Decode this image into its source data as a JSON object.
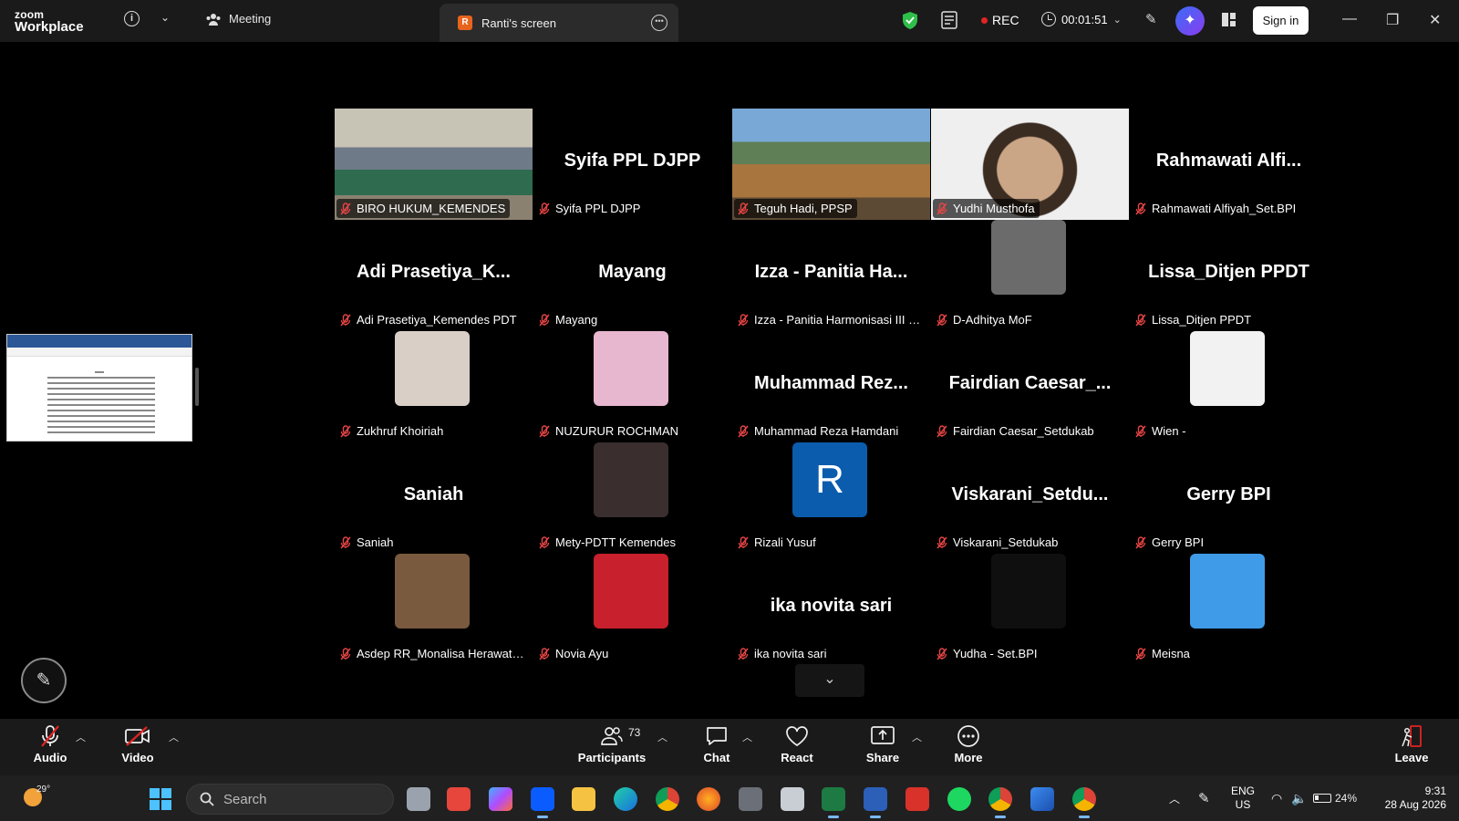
{
  "app": {
    "logo_line1": "zoom",
    "logo_line2": "Workplace"
  },
  "titlebar": {
    "meeting_label": "Meeting",
    "tab_badge": "R",
    "tab_label": "Ranti's screen",
    "rec_label": "REC",
    "timer": "00:01:51",
    "signin_label": "Sign in",
    "colors": {
      "rec": "#e02424",
      "shield": "#2fbf4a",
      "active_speaker": "#2fdc5a"
    }
  },
  "participants": [
    {
      "name": "BIRO HUKUM_KEMENDES",
      "display": "",
      "kind": "video",
      "fill": "img-room",
      "active": true
    },
    {
      "name": "Syifa PPL DJPP",
      "display": "Syifa PPL DJPP",
      "kind": "name"
    },
    {
      "name": "Teguh Hadi, PPSP",
      "display": "",
      "kind": "video",
      "fill": "img-houses"
    },
    {
      "name": "Yudhi Musthofa",
      "display": "",
      "kind": "video",
      "fill": "img-face"
    },
    {
      "name": "Rahmawati Alfiyah_Set.BPI",
      "display": "Rahmawati  Alfi...",
      "kind": "name"
    },
    {
      "name": "Adi Prasetiya_Kemendes PDT",
      "display": "Adi  Prasetiya_K...",
      "kind": "name"
    },
    {
      "name": "Mayang",
      "display": "Mayang",
      "kind": "name"
    },
    {
      "name": "Izza - Panitia Harmonisasi III RP...",
      "display": "Izza  -  Panitia  Ha...",
      "kind": "name"
    },
    {
      "name": "D-Adhitya MoF",
      "display": "",
      "kind": "avatar",
      "color": "#6b6b6b"
    },
    {
      "name": "Lissa_Ditjen PPDT",
      "display": "Lissa_Ditjen PPDT",
      "kind": "name"
    },
    {
      "name": "Zukhruf Khoiriah",
      "display": "",
      "kind": "avatar",
      "color": "#d9cfc7"
    },
    {
      "name": "NUZURUR ROCHMAN",
      "display": "",
      "kind": "avatar",
      "color": "#e7b6cf"
    },
    {
      "name": "Muhammad Reza Hamdani",
      "display": "Muhammad  Rez...",
      "kind": "name"
    },
    {
      "name": "Fairdian Caesar_Setdukab",
      "display": "Fairdian  Caesar_...",
      "kind": "name"
    },
    {
      "name": "Wien -",
      "display": "",
      "kind": "avatar",
      "color": "#f2f2f2"
    },
    {
      "name": "Saniah",
      "display": "Saniah",
      "kind": "name"
    },
    {
      "name": "Mety-PDTT Kemendes",
      "display": "",
      "kind": "avatar",
      "color": "#3a2e2e"
    },
    {
      "name": "Rizali Yusuf",
      "display": "R",
      "kind": "letter",
      "color": "#0b5cad"
    },
    {
      "name": "Viskarani_Setdukab",
      "display": "Viskarani_Setdu...",
      "kind": "name"
    },
    {
      "name": "Gerry BPI",
      "display": "Gerry BPI",
      "kind": "name"
    },
    {
      "name": "Asdep RR_Monalisa Herawati R...",
      "display": "",
      "kind": "avatar",
      "color": "#7a5a3e"
    },
    {
      "name": "Novia Ayu",
      "display": "",
      "kind": "avatar",
      "color": "#c8202c"
    },
    {
      "name": "ika novita sari",
      "display": "ika novita sari",
      "kind": "name"
    },
    {
      "name": "Yudha - Set.BPI",
      "display": "",
      "kind": "avatar",
      "color": "#0f0f0f"
    },
    {
      "name": "Meisna",
      "display": "",
      "kind": "avatar",
      "color": "#3f9be8"
    }
  ],
  "toolbar": {
    "audio": "Audio",
    "video": "Video",
    "participants": "Participants",
    "participants_count": "73",
    "chat": "Chat",
    "react": "React",
    "share": "Share",
    "more": "More",
    "leave": "Leave"
  },
  "taskbar": {
    "temperature": "29°",
    "search_placeholder": "Search",
    "language_line1": "ENG",
    "language_line2": "US",
    "battery": "24%",
    "time": "9:31",
    "date": "28 Aug 2026"
  }
}
